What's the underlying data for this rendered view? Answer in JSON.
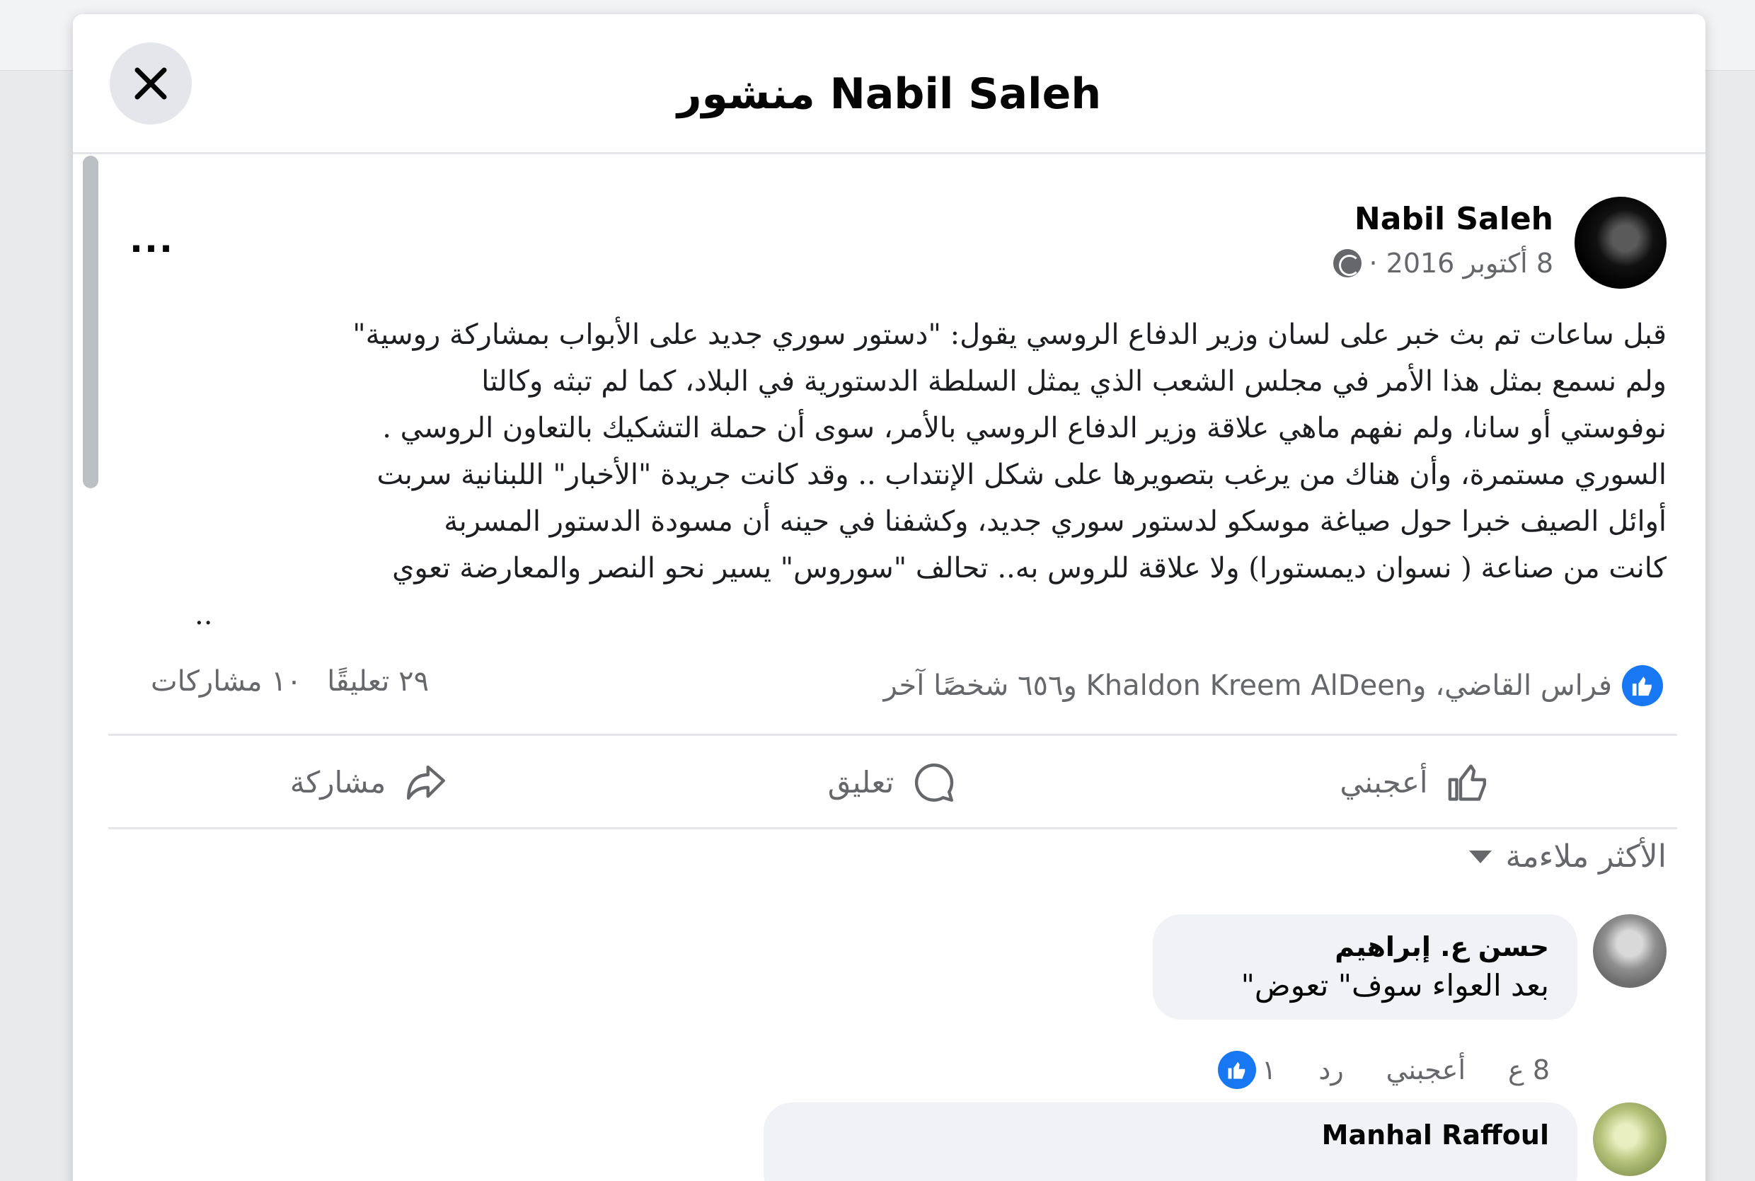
{
  "modal": {
    "title": "منشور Nabil Saleh",
    "close_icon": "close-icon"
  },
  "post": {
    "author": "Nabil Saleh",
    "date": "8 أكتوبر 2016 ·",
    "more_label": "...",
    "lines": [
      "قبل ساعات تم بث خبر على لسان وزير الدفاع الروسي يقول: \"دستور سوري جديد على الأبواب بمشاركة روسية\"",
      "ولم نسمع بمثل هذا الأمر في مجلس الشعب الذي يمثل السلطة الدستورية في البلاد، كما لم تبثه وكالتا",
      "نوفوستي أو سانا، ولم نفهم ماهي علاقة وزير الدفاع الروسي بالأمر، سوى أن حملة التشكيك بالتعاون الروسي .",
      "السوري مستمرة، وأن هناك من يرغب بتصويرها على شكل الإنتداب .. وقد كانت جريدة \"الأخبار\" اللبنانية سربت",
      "أوائل الصيف خبرا حول صياغة موسكو لدستور سوري جديد، وكشفنا في حينه أن مسودة الدستور المسربة",
      "كانت من صناعة ( نسوان ديمستورا) ولا علاقة للروس به.. تحالف \"سوروس\" يسير نحو النصر والمعارضة تعوي",
      ".."
    ]
  },
  "stats": {
    "reactors": "فراس القاضي، وKhaldon Kreem AlDeen و٦٥٦ شخصًا آخر",
    "comments": "٢٩ تعليقًا",
    "shares": "١٠ مشاركات"
  },
  "actions": {
    "like": "أعجبني",
    "comment": "تعليق",
    "share": "مشاركة"
  },
  "sort": {
    "label": "الأكثر ملاءمة"
  },
  "comments": [
    {
      "author": "حسن ع. إبراهيم",
      "text": "بعد العواء سوف\" تعوض\"",
      "time": "8 ع",
      "like_label": "أعجبني",
      "reply_label": "رد",
      "like_count": "١"
    },
    {
      "author": "Manhal Raffoul",
      "text": ""
    }
  ],
  "colors": {
    "accent": "#1877f2",
    "bubble": "#f0f2f5",
    "muted_text": "#65676b"
  }
}
